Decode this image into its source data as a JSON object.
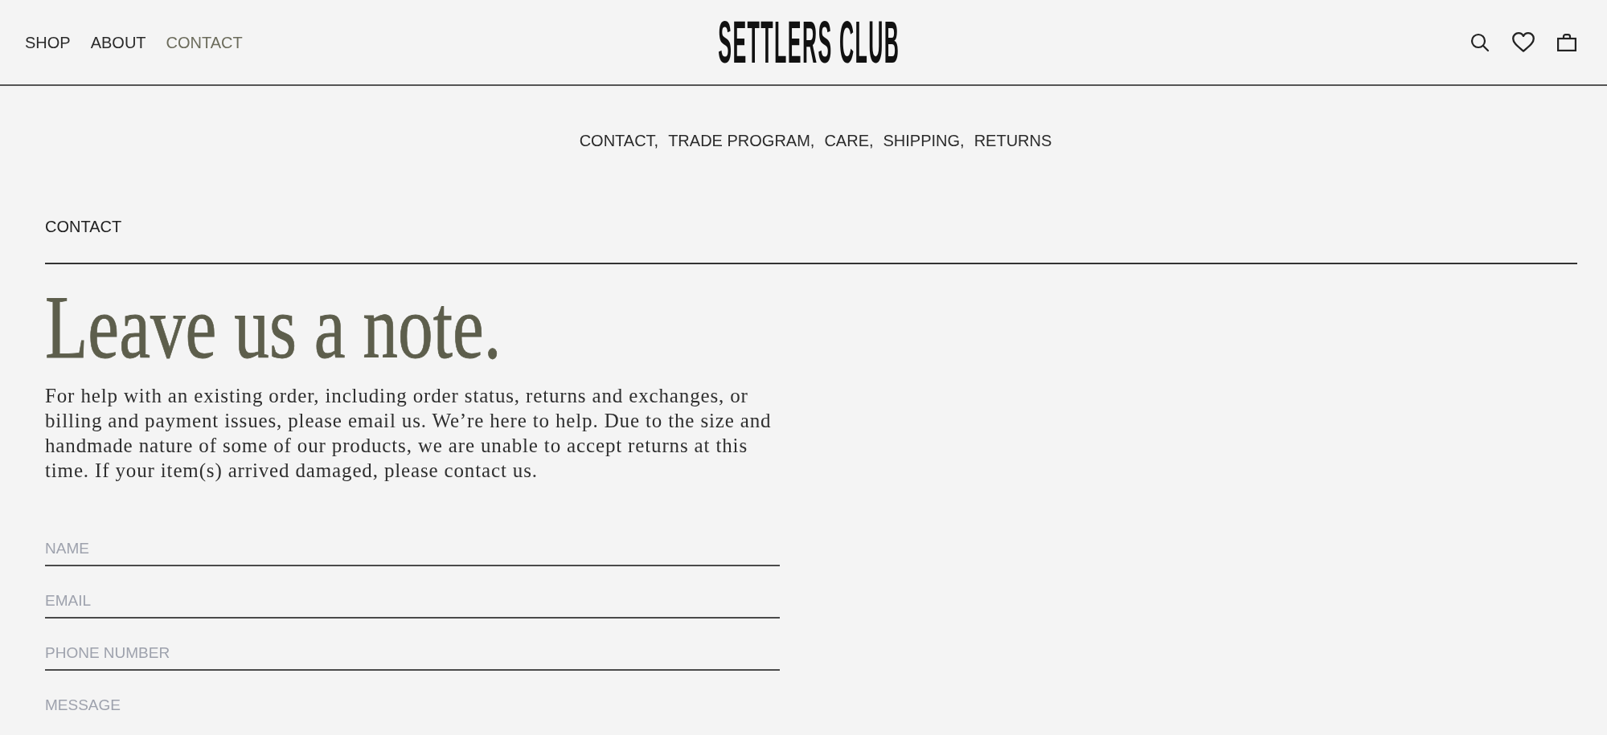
{
  "header": {
    "nav": [
      {
        "label": "SHOP",
        "selected": false
      },
      {
        "label": "ABOUT",
        "selected": false
      },
      {
        "label": "CONTACT",
        "selected": true
      }
    ],
    "logo": "SETTLERS CLUB"
  },
  "subnav": [
    {
      "label": "CONTACT,"
    },
    {
      "label": "TRADE PROGRAM,"
    },
    {
      "label": "CARE,"
    },
    {
      "label": "SHIPPING,"
    },
    {
      "label": "RETURNS"
    }
  ],
  "section_title": "CONTACT",
  "heading": "Leave us a note.",
  "intro": "For help with an existing order, including order status, returns and exchanges, or billing and payment issues, please email us. We’re here to help. Due to the size and handmade nature of some of our products, we are unable to accept returns at this time. If your item(s) arrived damaged, please contact us.",
  "form": {
    "fields": [
      {
        "kind": "text",
        "placeholder": "NAME"
      },
      {
        "kind": "text",
        "placeholder": "EMAIL"
      },
      {
        "kind": "text",
        "placeholder": "PHONE NUMBER"
      },
      {
        "kind": "textarea",
        "placeholder": "MESSAGE"
      }
    ]
  }
}
